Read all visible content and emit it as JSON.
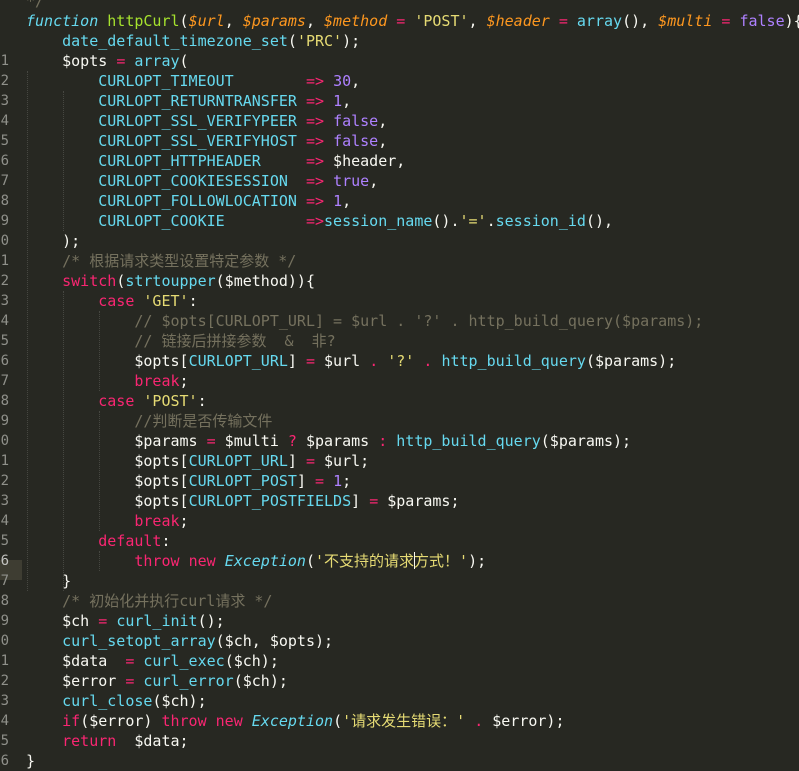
{
  "editor": {
    "lines": [
      {
        "n": "",
        "tokens": [
          {
            "t": "*/",
            "c": "cm"
          }
        ]
      },
      {
        "n": "",
        "tokens": [
          {
            "t": "function",
            "c": "st"
          },
          {
            "t": " ",
            "c": "pl"
          },
          {
            "t": "httpCurl",
            "c": "fn"
          },
          {
            "t": "(",
            "c": "pl"
          },
          {
            "t": "$url",
            "c": "pa"
          },
          {
            "t": ", ",
            "c": "pl"
          },
          {
            "t": "$params",
            "c": "pa"
          },
          {
            "t": ", ",
            "c": "pl"
          },
          {
            "t": "$method",
            "c": "pa"
          },
          {
            "t": " ",
            "c": "pl"
          },
          {
            "t": "=",
            "c": "kw"
          },
          {
            "t": " ",
            "c": "pl"
          },
          {
            "t": "'POST'",
            "c": "str"
          },
          {
            "t": ", ",
            "c": "pl"
          },
          {
            "t": "$header",
            "c": "pa"
          },
          {
            "t": " ",
            "c": "pl"
          },
          {
            "t": "=",
            "c": "kw"
          },
          {
            "t": " ",
            "c": "pl"
          },
          {
            "t": "array",
            "c": "bi"
          },
          {
            "t": "(), ",
            "c": "pl"
          },
          {
            "t": "$multi",
            "c": "pa"
          },
          {
            "t": " ",
            "c": "pl"
          },
          {
            "t": "=",
            "c": "kw"
          },
          {
            "t": " ",
            "c": "pl"
          },
          {
            "t": "false",
            "c": "num"
          },
          {
            "t": "){",
            "c": "pl"
          }
        ]
      },
      {
        "n": "",
        "tokens": [
          {
            "t": "    ",
            "c": "pl"
          },
          {
            "t": "date_default_timezone_set",
            "c": "bi"
          },
          {
            "t": "(",
            "c": "pl"
          },
          {
            "t": "'PRC'",
            "c": "str"
          },
          {
            "t": ");",
            "c": "pl"
          }
        ]
      },
      {
        "n": "1",
        "tokens": [
          {
            "t": "    $opts ",
            "c": "pl"
          },
          {
            "t": "=",
            "c": "kw"
          },
          {
            "t": " ",
            "c": "pl"
          },
          {
            "t": "array",
            "c": "bi"
          },
          {
            "t": "(",
            "c": "pl"
          }
        ]
      },
      {
        "n": "2",
        "tokens": [
          {
            "t": "        ",
            "c": "pl"
          },
          {
            "t": "CURLOPT_TIMEOUT",
            "c": "ct"
          },
          {
            "t": "        ",
            "c": "pl"
          },
          {
            "t": "=>",
            "c": "kw"
          },
          {
            "t": " ",
            "c": "pl"
          },
          {
            "t": "30",
            "c": "num"
          },
          {
            "t": ",",
            "c": "pl"
          }
        ]
      },
      {
        "n": "3",
        "tokens": [
          {
            "t": "        ",
            "c": "pl"
          },
          {
            "t": "CURLOPT_RETURNTRANSFER",
            "c": "ct"
          },
          {
            "t": " ",
            "c": "pl"
          },
          {
            "t": "=>",
            "c": "kw"
          },
          {
            "t": " ",
            "c": "pl"
          },
          {
            "t": "1",
            "c": "num"
          },
          {
            "t": ",",
            "c": "pl"
          }
        ]
      },
      {
        "n": "4",
        "tokens": [
          {
            "t": "        ",
            "c": "pl"
          },
          {
            "t": "CURLOPT_SSL_VERIFYPEER",
            "c": "ct"
          },
          {
            "t": " ",
            "c": "pl"
          },
          {
            "t": "=>",
            "c": "kw"
          },
          {
            "t": " ",
            "c": "pl"
          },
          {
            "t": "false",
            "c": "num"
          },
          {
            "t": ",",
            "c": "pl"
          }
        ]
      },
      {
        "n": "5",
        "tokens": [
          {
            "t": "        ",
            "c": "pl"
          },
          {
            "t": "CURLOPT_SSL_VERIFYHOST",
            "c": "ct"
          },
          {
            "t": " ",
            "c": "pl"
          },
          {
            "t": "=>",
            "c": "kw"
          },
          {
            "t": " ",
            "c": "pl"
          },
          {
            "t": "false",
            "c": "num"
          },
          {
            "t": ",",
            "c": "pl"
          }
        ]
      },
      {
        "n": "6",
        "tokens": [
          {
            "t": "        ",
            "c": "pl"
          },
          {
            "t": "CURLOPT_HTTPHEADER",
            "c": "ct"
          },
          {
            "t": "     ",
            "c": "pl"
          },
          {
            "t": "=>",
            "c": "kw"
          },
          {
            "t": " $header,",
            "c": "pl"
          }
        ]
      },
      {
        "n": "7",
        "tokens": [
          {
            "t": "        ",
            "c": "pl"
          },
          {
            "t": "CURLOPT_COOKIESESSION",
            "c": "ct"
          },
          {
            "t": "  ",
            "c": "pl"
          },
          {
            "t": "=>",
            "c": "kw"
          },
          {
            "t": " ",
            "c": "pl"
          },
          {
            "t": "true",
            "c": "num"
          },
          {
            "t": ",",
            "c": "pl"
          }
        ]
      },
      {
        "n": "8",
        "tokens": [
          {
            "t": "        ",
            "c": "pl"
          },
          {
            "t": "CURLOPT_FOLLOWLOCATION",
            "c": "ct"
          },
          {
            "t": " ",
            "c": "pl"
          },
          {
            "t": "=>",
            "c": "kw"
          },
          {
            "t": " ",
            "c": "pl"
          },
          {
            "t": "1",
            "c": "num"
          },
          {
            "t": ",",
            "c": "pl"
          }
        ]
      },
      {
        "n": "9",
        "tokens": [
          {
            "t": "        ",
            "c": "pl"
          },
          {
            "t": "CURLOPT_COOKIE",
            "c": "ct"
          },
          {
            "t": "         ",
            "c": "pl"
          },
          {
            "t": "=>",
            "c": "kw"
          },
          {
            "t": "session_name",
            "c": "bi"
          },
          {
            "t": "().",
            "c": "pl"
          },
          {
            "t": "'='",
            "c": "str"
          },
          {
            "t": ".",
            "c": "pl"
          },
          {
            "t": "session_id",
            "c": "bi"
          },
          {
            "t": "(),",
            "c": "pl"
          }
        ]
      },
      {
        "n": "0",
        "tokens": [
          {
            "t": "    );",
            "c": "pl"
          }
        ]
      },
      {
        "n": "1",
        "tokens": [
          {
            "t": "    ",
            "c": "pl"
          },
          {
            "t": "/* 根据请求类型设置特定参数 */",
            "c": "cm"
          }
        ]
      },
      {
        "n": "2",
        "tokens": [
          {
            "t": "    ",
            "c": "pl"
          },
          {
            "t": "switch",
            "c": "kw"
          },
          {
            "t": "(",
            "c": "pl"
          },
          {
            "t": "strtoupper",
            "c": "bi"
          },
          {
            "t": "($method)){",
            "c": "pl"
          }
        ]
      },
      {
        "n": "3",
        "tokens": [
          {
            "t": "        ",
            "c": "pl"
          },
          {
            "t": "case",
            "c": "kw"
          },
          {
            "t": " ",
            "c": "pl"
          },
          {
            "t": "'GET'",
            "c": "str"
          },
          {
            "t": ":",
            "c": "pl"
          }
        ]
      },
      {
        "n": "4",
        "tokens": [
          {
            "t": "            ",
            "c": "pl"
          },
          {
            "t": "// $opts[CURLOPT_URL] = $url . '?' . http_build_query($params);",
            "c": "cm"
          }
        ]
      },
      {
        "n": "5",
        "tokens": [
          {
            "t": "            ",
            "c": "pl"
          },
          {
            "t": "// 链接后拼接参数  &  非?",
            "c": "cm"
          }
        ]
      },
      {
        "n": "6",
        "tokens": [
          {
            "t": "            $opts[",
            "c": "pl"
          },
          {
            "t": "CURLOPT_URL",
            "c": "ct"
          },
          {
            "t": "] ",
            "c": "pl"
          },
          {
            "t": "=",
            "c": "kw"
          },
          {
            "t": " $url ",
            "c": "pl"
          },
          {
            "t": ".",
            "c": "kw"
          },
          {
            "t": " ",
            "c": "pl"
          },
          {
            "t": "'?'",
            "c": "str"
          },
          {
            "t": " ",
            "c": "pl"
          },
          {
            "t": ".",
            "c": "kw"
          },
          {
            "t": " ",
            "c": "pl"
          },
          {
            "t": "http_build_query",
            "c": "bi"
          },
          {
            "t": "($params);",
            "c": "pl"
          }
        ]
      },
      {
        "n": "7",
        "tokens": [
          {
            "t": "            ",
            "c": "pl"
          },
          {
            "t": "break",
            "c": "kw"
          },
          {
            "t": ";",
            "c": "pl"
          }
        ]
      },
      {
        "n": "8",
        "tokens": [
          {
            "t": "        ",
            "c": "pl"
          },
          {
            "t": "case",
            "c": "kw"
          },
          {
            "t": " ",
            "c": "pl"
          },
          {
            "t": "'POST'",
            "c": "str"
          },
          {
            "t": ":",
            "c": "pl"
          }
        ]
      },
      {
        "n": "9",
        "tokens": [
          {
            "t": "            ",
            "c": "pl"
          },
          {
            "t": "//判断是否传输文件",
            "c": "cm"
          }
        ]
      },
      {
        "n": "0",
        "tokens": [
          {
            "t": "            $params ",
            "c": "pl"
          },
          {
            "t": "=",
            "c": "kw"
          },
          {
            "t": " $multi ",
            "c": "pl"
          },
          {
            "t": "?",
            "c": "kw"
          },
          {
            "t": " $params ",
            "c": "pl"
          },
          {
            "t": ":",
            "c": "kw"
          },
          {
            "t": " ",
            "c": "pl"
          },
          {
            "t": "http_build_query",
            "c": "bi"
          },
          {
            "t": "($params);",
            "c": "pl"
          }
        ]
      },
      {
        "n": "1",
        "tokens": [
          {
            "t": "            $opts[",
            "c": "pl"
          },
          {
            "t": "CURLOPT_URL",
            "c": "ct"
          },
          {
            "t": "] ",
            "c": "pl"
          },
          {
            "t": "=",
            "c": "kw"
          },
          {
            "t": " $url;",
            "c": "pl"
          }
        ]
      },
      {
        "n": "2",
        "tokens": [
          {
            "t": "            $opts[",
            "c": "pl"
          },
          {
            "t": "CURLOPT_POST",
            "c": "ct"
          },
          {
            "t": "] ",
            "c": "pl"
          },
          {
            "t": "=",
            "c": "kw"
          },
          {
            "t": " ",
            "c": "pl"
          },
          {
            "t": "1",
            "c": "num"
          },
          {
            "t": ";",
            "c": "pl"
          }
        ]
      },
      {
        "n": "3",
        "tokens": [
          {
            "t": "            $opts[",
            "c": "pl"
          },
          {
            "t": "CURLOPT_POSTFIELDS",
            "c": "ct"
          },
          {
            "t": "] ",
            "c": "pl"
          },
          {
            "t": "=",
            "c": "kw"
          },
          {
            "t": " $params;",
            "c": "pl"
          }
        ]
      },
      {
        "n": "4",
        "tokens": [
          {
            "t": "            ",
            "c": "pl"
          },
          {
            "t": "break",
            "c": "kw"
          },
          {
            "t": ";",
            "c": "pl"
          }
        ]
      },
      {
        "n": "5",
        "tokens": [
          {
            "t": "        ",
            "c": "pl"
          },
          {
            "t": "default",
            "c": "kw"
          },
          {
            "t": ":",
            "c": "pl"
          }
        ]
      },
      {
        "n": "6",
        "active": true,
        "tokens": [
          {
            "t": "            ",
            "c": "pl"
          },
          {
            "t": "throw",
            "c": "kw"
          },
          {
            "t": " ",
            "c": "pl"
          },
          {
            "t": "new",
            "c": "kw"
          },
          {
            "t": " ",
            "c": "pl"
          },
          {
            "t": "Exception",
            "c": "ex"
          },
          {
            "t": "(",
            "c": "pl"
          },
          {
            "t": "'不支持的请求",
            "c": "str"
          },
          {
            "t": "|",
            "c": "caret"
          },
          {
            "t": "方式！'",
            "c": "str"
          },
          {
            "t": ");",
            "c": "pl"
          }
        ]
      },
      {
        "n": "7",
        "tokens": [
          {
            "t": "    }",
            "c": "pl"
          }
        ]
      },
      {
        "n": "8",
        "tokens": [
          {
            "t": "    ",
            "c": "pl"
          },
          {
            "t": "/* 初始化并执行curl请求 */",
            "c": "cm"
          }
        ]
      },
      {
        "n": "9",
        "tokens": [
          {
            "t": "    $ch ",
            "c": "pl"
          },
          {
            "t": "=",
            "c": "kw"
          },
          {
            "t": " ",
            "c": "pl"
          },
          {
            "t": "curl_init",
            "c": "bi"
          },
          {
            "t": "();",
            "c": "pl"
          }
        ]
      },
      {
        "n": "0",
        "tokens": [
          {
            "t": "    ",
            "c": "pl"
          },
          {
            "t": "curl_setopt_array",
            "c": "bi"
          },
          {
            "t": "($ch, $opts);",
            "c": "pl"
          }
        ]
      },
      {
        "n": "1",
        "tokens": [
          {
            "t": "    $data  ",
            "c": "pl"
          },
          {
            "t": "=",
            "c": "kw"
          },
          {
            "t": " ",
            "c": "pl"
          },
          {
            "t": "curl_exec",
            "c": "bi"
          },
          {
            "t": "($ch);",
            "c": "pl"
          }
        ]
      },
      {
        "n": "2",
        "tokens": [
          {
            "t": "    $error ",
            "c": "pl"
          },
          {
            "t": "=",
            "c": "kw"
          },
          {
            "t": " ",
            "c": "pl"
          },
          {
            "t": "curl_error",
            "c": "bi"
          },
          {
            "t": "($ch);",
            "c": "pl"
          }
        ]
      },
      {
        "n": "3",
        "tokens": [
          {
            "t": "    ",
            "c": "pl"
          },
          {
            "t": "curl_close",
            "c": "bi"
          },
          {
            "t": "($ch);",
            "c": "pl"
          }
        ]
      },
      {
        "n": "4",
        "tokens": [
          {
            "t": "    ",
            "c": "pl"
          },
          {
            "t": "if",
            "c": "kw"
          },
          {
            "t": "($error) ",
            "c": "pl"
          },
          {
            "t": "throw",
            "c": "kw"
          },
          {
            "t": " ",
            "c": "pl"
          },
          {
            "t": "new",
            "c": "kw"
          },
          {
            "t": " ",
            "c": "pl"
          },
          {
            "t": "Exception",
            "c": "ex"
          },
          {
            "t": "(",
            "c": "pl"
          },
          {
            "t": "'请求发生错误：'",
            "c": "str"
          },
          {
            "t": " ",
            "c": "pl"
          },
          {
            "t": ".",
            "c": "kw"
          },
          {
            "t": " $error);",
            "c": "pl"
          }
        ]
      },
      {
        "n": "5",
        "tokens": [
          {
            "t": "    ",
            "c": "pl"
          },
          {
            "t": "return",
            "c": "kw"
          },
          {
            "t": "  $data;",
            "c": "pl"
          }
        ]
      },
      {
        "n": "6",
        "tokens": [
          {
            "t": "}",
            "c": "pl"
          }
        ]
      }
    ]
  },
  "colors": {
    "background": "#272822",
    "gutter_text": "#8f908a",
    "keyword": "#f92672",
    "function_name": "#a6e22e",
    "support": "#66d9ef",
    "parameter": "#fd971f",
    "string": "#e6db74",
    "number": "#ae81ff",
    "comment": "#75715e",
    "plain": "#f8f8f2"
  }
}
